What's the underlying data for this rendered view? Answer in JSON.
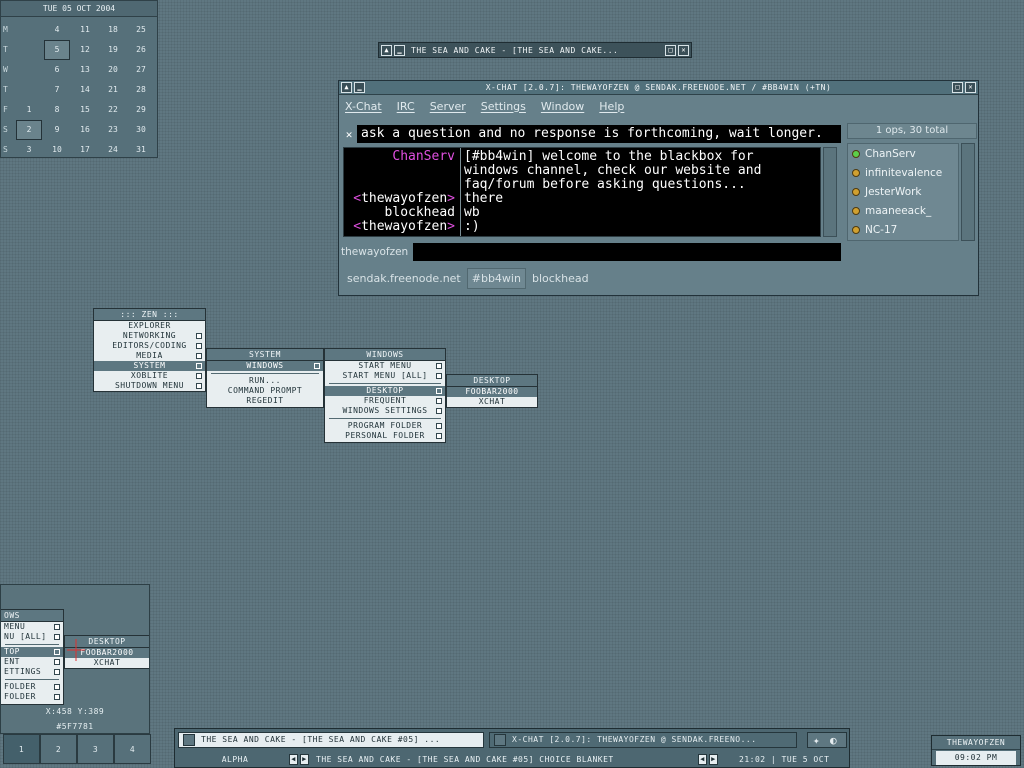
{
  "calendar": {
    "header": "TUE 05 OCT 2004",
    "weekday_letters": [
      "M",
      "T",
      "W",
      "T",
      "F",
      "S",
      "S"
    ],
    "weeks": [
      [
        "",
        "",
        "",
        "",
        "",
        "",
        "3"
      ],
      [
        "4",
        "5",
        "6",
        "7",
        "8",
        "9",
        "10"
      ],
      [
        "11",
        "12",
        "13",
        "14",
        "15",
        "16",
        "17"
      ],
      [
        "18",
        "19",
        "20",
        "21",
        "22",
        "23",
        "24"
      ],
      [
        "25",
        "26",
        "27",
        "28",
        "29",
        "30",
        "31"
      ]
    ],
    "first_col": [
      "",
      "",
      "",
      "",
      "1",
      "2",
      "3"
    ]
  },
  "music_window": {
    "title": "THE SEA AND CAKE - [THE SEA AND CAKE..."
  },
  "xchat": {
    "title": "X-CHAT [2.0.7]: THEWAYOFZEN @ SENDAK.FREENODE.NET / #BB4WIN (+TN)",
    "menus": [
      "X-Chat",
      "IRC",
      "Server",
      "Settings",
      "Window",
      "Help"
    ],
    "topic": "ask a question and no response is forthcoming, wait longer.",
    "lines": [
      {
        "nick": "ChanServ",
        "open": "",
        "close": "",
        "color": "#e050e0",
        "text": "[#bb4win] welcome to the blackbox for"
      },
      {
        "nick": "",
        "open": "",
        "close": "",
        "color": "#ffffff",
        "text": "windows channel, check our website and"
      },
      {
        "nick": "",
        "open": "",
        "close": "",
        "color": "#ffffff",
        "text": "faq/forum before asking questions..."
      },
      {
        "nick": "thewayofzen",
        "open": "<",
        "close": ">",
        "color": "#ffffff",
        "text": "there"
      },
      {
        "nick": "blockhead",
        "open": "",
        "close": "",
        "color": "#ffffff",
        "text": "wb"
      },
      {
        "nick": "thewayofzen",
        "open": "<",
        "close": ">",
        "color": "#ffffff",
        "text": ":)"
      }
    ],
    "ops_count": "1 ops, 30 total",
    "users": [
      {
        "name": "ChanServ",
        "dot": "#5cd04a"
      },
      {
        "name": "infinitevalence",
        "dot": "#d0a030"
      },
      {
        "name": "JesterWork",
        "dot": "#d0a030"
      },
      {
        "name": "maaneeack_",
        "dot": "#d0a030"
      },
      {
        "name": "NC-17",
        "dot": "#d0a030"
      }
    ],
    "input_nick": "thewayofzen",
    "tabs": [
      "sendak.freenode.net",
      "#bb4win",
      "blockhead"
    ]
  },
  "menus": {
    "zen": {
      "title": "::: ZEN :::",
      "items": [
        "EXPLORER",
        "NETWORKING",
        "EDITORS/CODING",
        "MEDIA",
        "SYSTEM",
        "XOBLITE",
        "SHUTDOWN MENU"
      ]
    },
    "system": {
      "title": "SYSTEM",
      "items": [
        "WINDOWS",
        "RUN...",
        "COMMAND PROMPT",
        "REGEDIT"
      ]
    },
    "windows": {
      "title": "WINDOWS",
      "items": [
        "START MENU",
        "START MENU [ALL]",
        "DESKTOP",
        "FREQUENT",
        "WINDOWS SETTINGS",
        "PROGRAM FOLDER",
        "PERSONAL FOLDER"
      ]
    },
    "desktop": {
      "title": "DESKTOP",
      "items": [
        "FOOBAR2000",
        "XCHAT"
      ]
    }
  },
  "pager": {
    "mini_title": "OWS",
    "mini_items": [
      "MENU",
      "NU [ALL]",
      "TOP",
      "ENT",
      "ETTINGS",
      "FOLDER",
      "FOLDER"
    ],
    "mini_desktop_title": "DESKTOP",
    "mini_desktop_items": [
      "FOOBAR2000",
      "XCHAT"
    ],
    "coords": "X:458 Y:389",
    "color_hex": "#5F7781",
    "workspaces": [
      "1",
      "2",
      "3",
      "4"
    ]
  },
  "taskbar": {
    "tasks": [
      "THE SEA AND CAKE - [THE SEA AND CAKE #05] ...",
      "X-CHAT [2.0.7]: THEWAYOFZEN @ SENDAK.FREENO..."
    ],
    "workspace_name": "ALPHA",
    "now_playing": "THE SEA AND CAKE - [THE SEA AND CAKE #05] CHOICE BLANKET",
    "clock_date": "21:02 | TUE 5 OCT"
  },
  "clockbox": {
    "user": "THEWAYOFZEN",
    "time": "09:02 PM"
  }
}
